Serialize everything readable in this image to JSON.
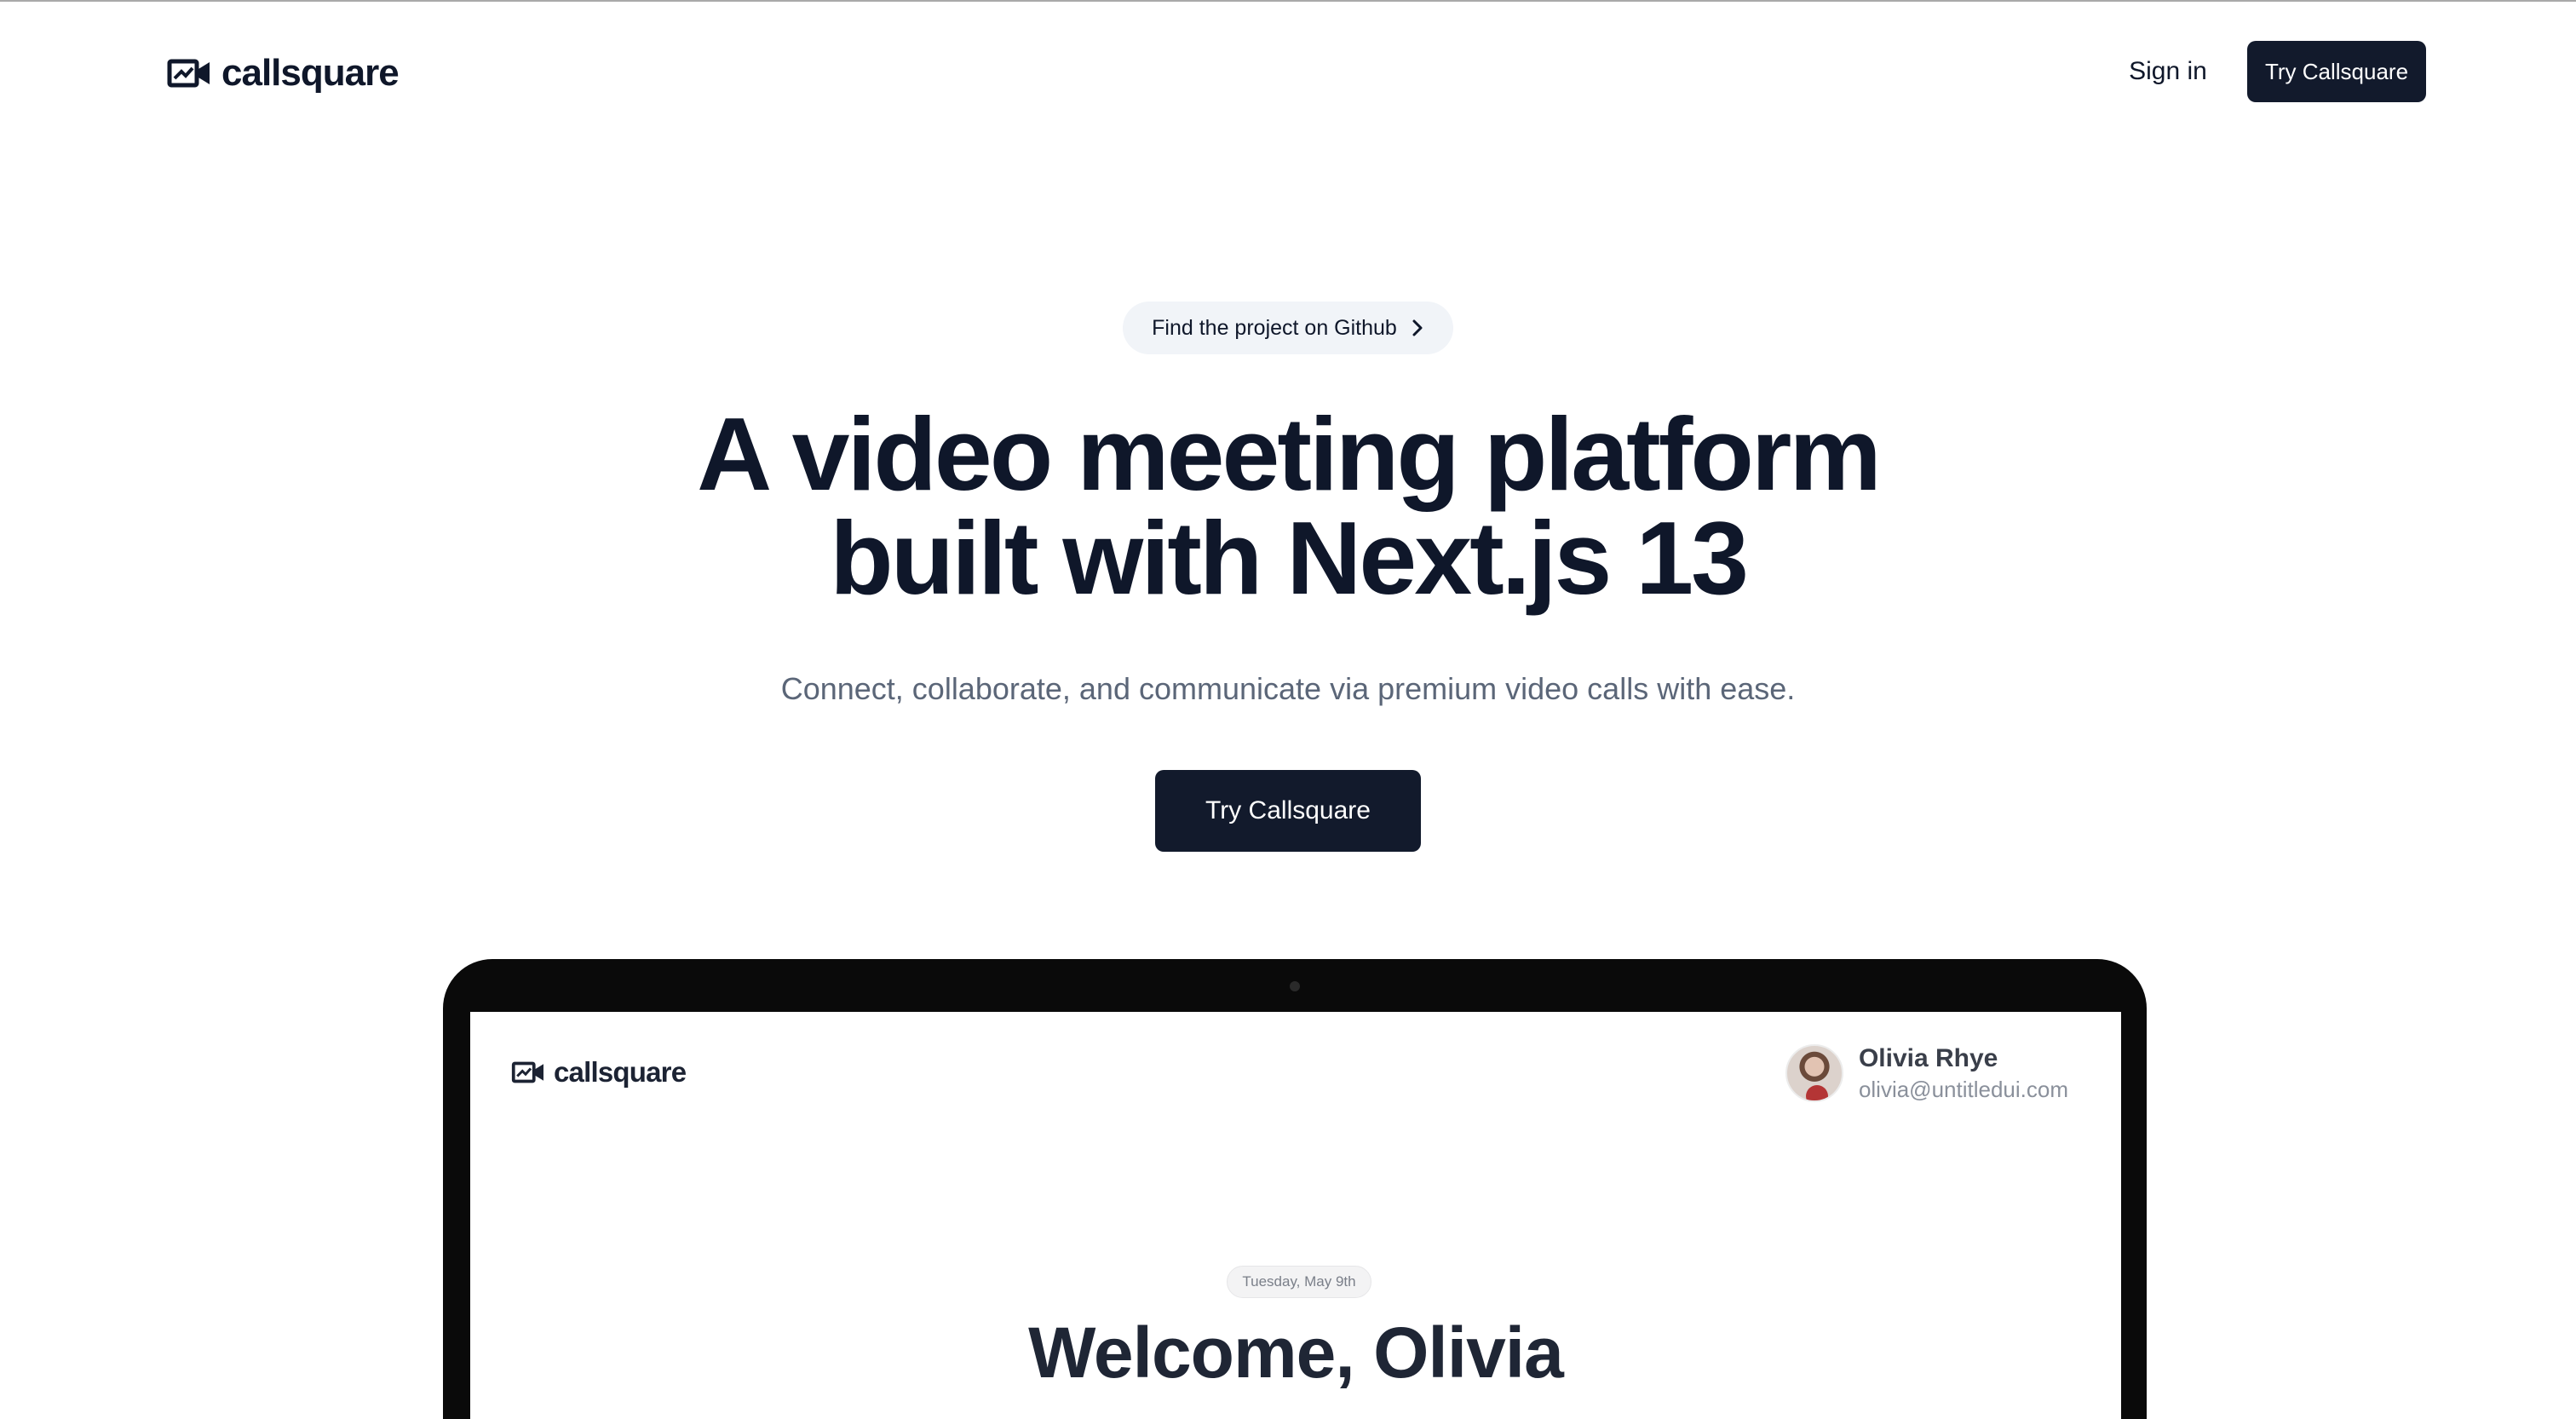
{
  "nav": {
    "brand_name": "callsquare",
    "sign_in_label": "Sign in",
    "try_label": "Try Callsquare"
  },
  "hero": {
    "pill_label": "Find the project on Github",
    "headline_line1": "A video meeting platform",
    "headline_line2": "built with Next.js 13",
    "subheadline": "Connect, collaborate, and communicate via premium video calls with ease.",
    "cta_label": "Try Callsquare"
  },
  "preview": {
    "brand_name": "callsquare",
    "user_name": "Olivia Rhye",
    "user_email": "olivia@untitledui.com",
    "date_label": "Tuesday, May 9th",
    "welcome_text": "Welcome, Olivia"
  },
  "colors": {
    "primary_button": "#121a2c",
    "text": "#0f172a",
    "muted_text": "#5b6678",
    "pill_bg": "#f1f4f8"
  }
}
